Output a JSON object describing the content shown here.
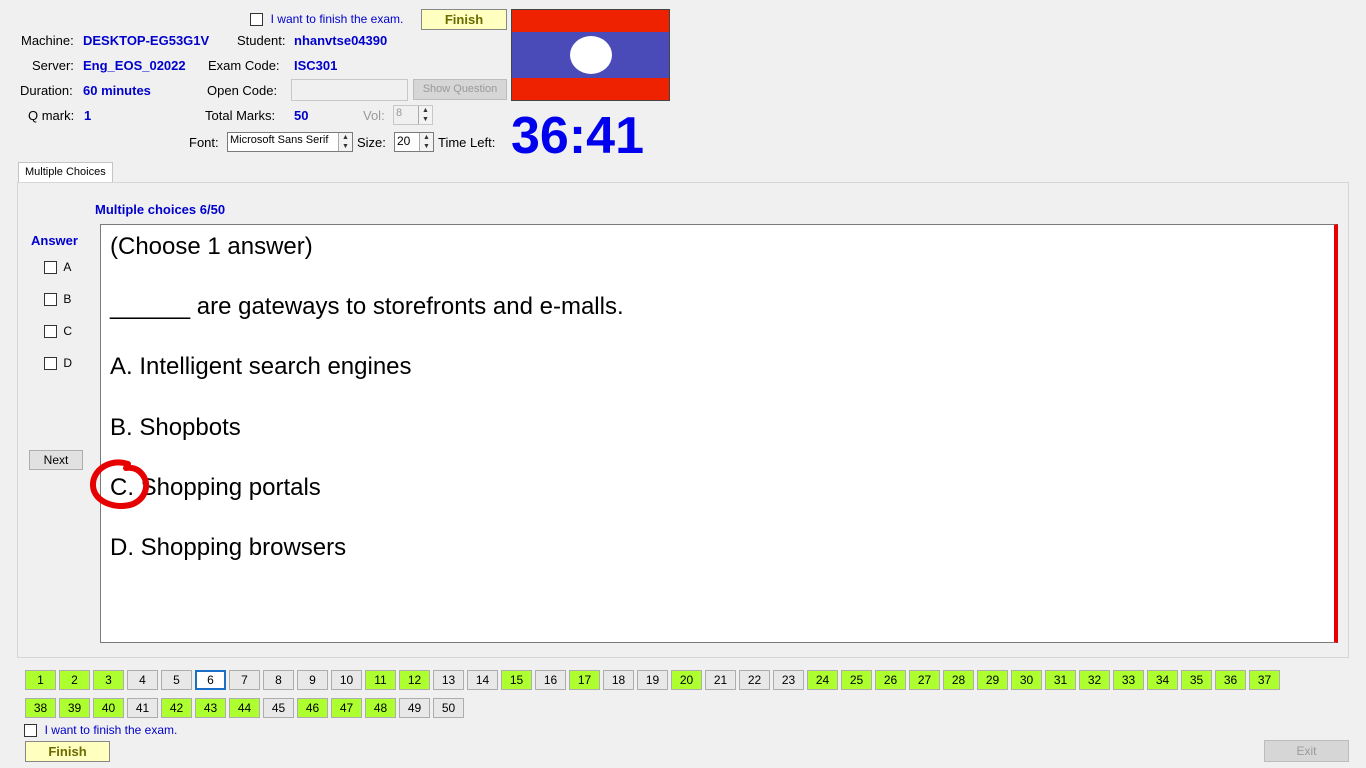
{
  "header": {
    "finish_check_label": "I want to finish the exam.",
    "finish_button": "Finish",
    "machine_label": "Machine:",
    "machine_value": "DESKTOP-EG53G1V",
    "student_label": "Student:",
    "student_value": "nhanvtse04390",
    "server_label": "Server:",
    "server_value": "Eng_EOS_02022",
    "exam_code_label": "Exam Code:",
    "exam_code_value": "ISC301",
    "duration_label": "Duration:",
    "duration_value": "60 minutes",
    "open_code_label": "Open Code:",
    "open_code_value": "",
    "show_question_button": "Show Question",
    "qmark_label": "Q mark:",
    "qmark_value": "1",
    "total_marks_label": "Total Marks:",
    "total_marks_value": "50",
    "vol_label": "Vol:",
    "vol_value": "8",
    "font_label": "Font:",
    "font_value": "Microsoft Sans Serif",
    "size_label": "Size:",
    "size_value": "20",
    "time_left_label": "Time Left:",
    "time_left_value": "36:41",
    "flag_colors": {
      "red": "#ee2200",
      "blue": "#4a4ab8",
      "white": "#ffffff"
    }
  },
  "tabs": [
    {
      "label": "Multiple Choices"
    }
  ],
  "question": {
    "progress": "Multiple choices 6/50",
    "answer_heading": "Answer",
    "answer_options": [
      "A",
      "B",
      "C",
      "D"
    ],
    "next_button": "Next",
    "lines": [
      "(Choose 1 answer)",
      "______ are gateways to storefronts and e-malls.",
      "A.  Intelligent search engines",
      "B.  Shopbots",
      "C.  Shopping portals",
      "D.  Shopping browsers"
    ],
    "accent_color": "#e60000"
  },
  "navigator": {
    "current": 6,
    "answered_color": "#adff2f",
    "buttons": [
      {
        "n": "1",
        "done": true
      },
      {
        "n": "2",
        "done": true
      },
      {
        "n": "3",
        "done": true
      },
      {
        "n": "4",
        "done": false
      },
      {
        "n": "5",
        "done": false
      },
      {
        "n": "6",
        "done": false
      },
      {
        "n": "7",
        "done": false
      },
      {
        "n": "8",
        "done": false
      },
      {
        "n": "9",
        "done": false
      },
      {
        "n": "10",
        "done": false
      },
      {
        "n": "11",
        "done": true
      },
      {
        "n": "12",
        "done": true
      },
      {
        "n": "13",
        "done": false
      },
      {
        "n": "14",
        "done": false
      },
      {
        "n": "15",
        "done": true
      },
      {
        "n": "16",
        "done": false
      },
      {
        "n": "17",
        "done": true
      },
      {
        "n": "18",
        "done": false
      },
      {
        "n": "19",
        "done": false
      },
      {
        "n": "20",
        "done": true
      },
      {
        "n": "21",
        "done": false
      },
      {
        "n": "22",
        "done": false
      },
      {
        "n": "23",
        "done": false
      },
      {
        "n": "24",
        "done": true
      },
      {
        "n": "25",
        "done": true
      },
      {
        "n": "26",
        "done": true
      },
      {
        "n": "27",
        "done": true
      },
      {
        "n": "28",
        "done": true
      },
      {
        "n": "29",
        "done": true
      },
      {
        "n": "30",
        "done": true
      },
      {
        "n": "31",
        "done": true
      },
      {
        "n": "32",
        "done": true
      },
      {
        "n": "33",
        "done": true
      },
      {
        "n": "34",
        "done": true
      },
      {
        "n": "35",
        "done": true
      },
      {
        "n": "36",
        "done": true
      },
      {
        "n": "37",
        "done": true
      },
      {
        "n": "38",
        "done": true
      },
      {
        "n": "39",
        "done": true
      },
      {
        "n": "40",
        "done": true
      },
      {
        "n": "41",
        "done": false
      },
      {
        "n": "42",
        "done": true
      },
      {
        "n": "43",
        "done": true
      },
      {
        "n": "44",
        "done": true
      },
      {
        "n": "45",
        "done": false
      },
      {
        "n": "46",
        "done": true
      },
      {
        "n": "47",
        "done": true
      },
      {
        "n": "48",
        "done": true
      },
      {
        "n": "49",
        "done": false
      },
      {
        "n": "50",
        "done": false
      }
    ]
  },
  "footer": {
    "finish_check_label": "I want to finish the exam.",
    "finish_button": "Finish",
    "exit_button": "Exit"
  }
}
